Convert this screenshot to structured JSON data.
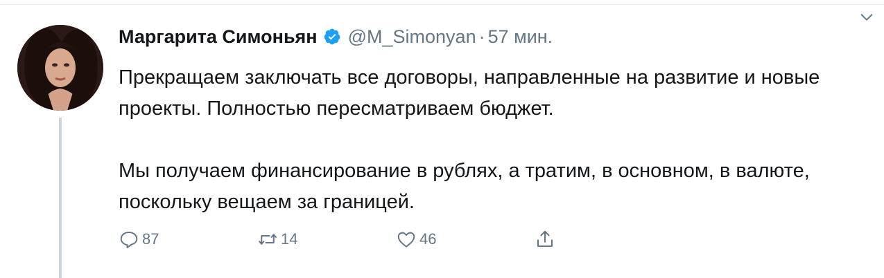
{
  "tweet": {
    "author_name": "Маргарита Симоньян",
    "handle": "@M_Simonyan",
    "separator": "·",
    "time": "57 мин.",
    "paragraphs": [
      "Прекращаем заключать все договоры, направленные на развитие и новые проекты. Полностью пересматриваем бюджет.",
      "Мы получаем финансирование в рублях, а тратим, в основном, в валюте, поскольку вещаем за границей."
    ],
    "actions": {
      "replies": "87",
      "retweets": "14",
      "likes": "46"
    }
  },
  "icons": {
    "verified": "verified-badge-icon",
    "more": "chevron-down-icon",
    "reply": "reply-icon",
    "retweet": "retweet-icon",
    "like": "heart-icon",
    "share": "share-icon"
  },
  "colors": {
    "accent": "#1da1f2",
    "secondary_text": "#657786",
    "thread_line": "#ccd6dd"
  }
}
